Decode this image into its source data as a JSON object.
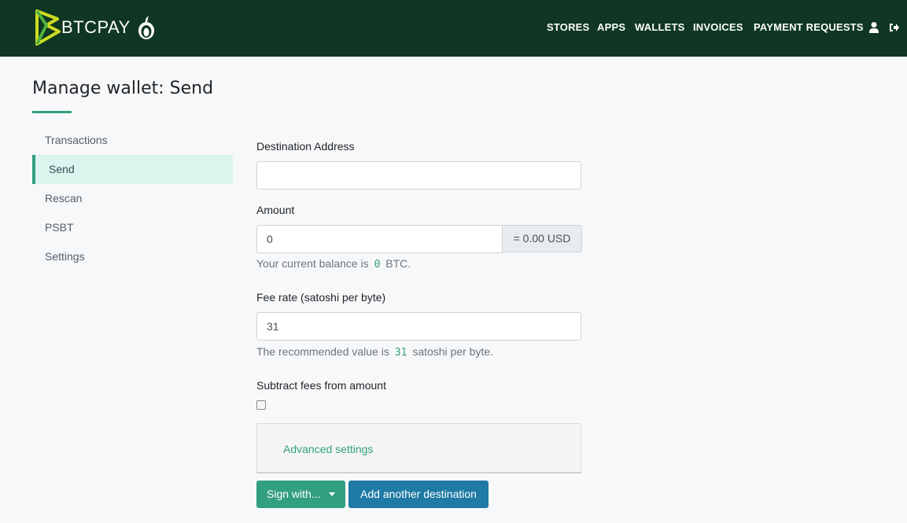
{
  "header": {
    "brand": "BTCPAY",
    "nav": {
      "stores": "STORES",
      "apps": "APPS",
      "wallets": "WALLETS",
      "invoices": "INVOICES",
      "payment_requests": "PAYMENT REQUESTS"
    },
    "icons": [
      "btcpay-logo-icon",
      "tor-onion-icon",
      "user-icon",
      "logout-icon"
    ]
  },
  "page": {
    "title": "Manage wallet: Send"
  },
  "sidebar": {
    "items": [
      {
        "label": "Transactions",
        "active": false
      },
      {
        "label": "Send",
        "active": true
      },
      {
        "label": "Rescan",
        "active": false
      },
      {
        "label": "PSBT",
        "active": false
      },
      {
        "label": "Settings",
        "active": false
      }
    ]
  },
  "form": {
    "destination": {
      "label": "Destination Address",
      "value": ""
    },
    "amount": {
      "label": "Amount",
      "value": "0",
      "fiat": "= 0.00 USD",
      "help_prefix": "Your current balance is",
      "help_value": "0",
      "help_suffix": "BTC."
    },
    "fee": {
      "label": "Fee rate (satoshi per byte)",
      "value": "31",
      "help_prefix": "The recommended value is",
      "help_value": "31",
      "help_suffix": "satoshi per byte."
    },
    "subtract_fees": {
      "label": "Subtract fees from amount",
      "checked": false
    },
    "advanced": {
      "label": "Advanced settings"
    }
  },
  "buttons": {
    "sign": "Sign with...",
    "add_destination": "Add another destination"
  },
  "colors": {
    "header_bg": "#0f3723",
    "accent": "#329f80",
    "secondary_button": "#1f7aa5",
    "active_sidebar_bg": "#d9f5ed"
  }
}
